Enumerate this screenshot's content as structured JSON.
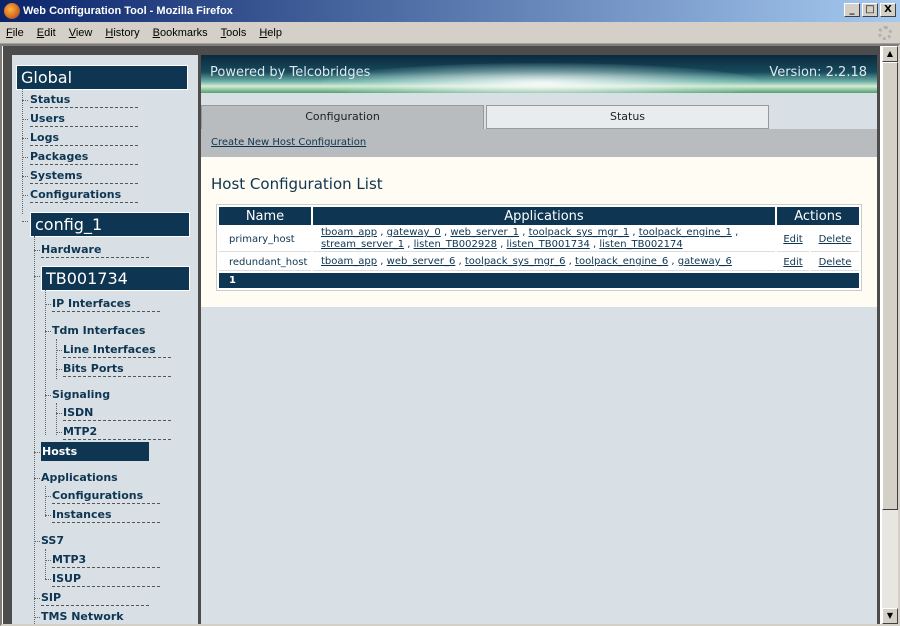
{
  "window": {
    "title": "Web Configuration Tool - Mozilla Firefox",
    "minimize": "_",
    "maximize": "□",
    "close": "X"
  },
  "menu": [
    "File",
    "Edit",
    "View",
    "History",
    "Bookmarks",
    "Tools",
    "Help"
  ],
  "sidebar": {
    "global_header": "Global",
    "global_items": [
      "Status",
      "Users",
      "Logs",
      "Packages",
      "Systems",
      "Configurations"
    ],
    "config_header": "config_1",
    "hardware": "Hardware",
    "device_header": "TB001734",
    "ip_interfaces": "IP Interfaces",
    "tdm_interfaces": "Tdm Interfaces",
    "line_interfaces": "Line Interfaces",
    "bits_ports": "Bits Ports",
    "signaling": "Signaling",
    "isdn": "ISDN",
    "mtp2": "MTP2",
    "hosts": "Hosts",
    "applications": "Applications",
    "app_configurations": "Configurations",
    "instances": "Instances",
    "ss7": "SS7",
    "mtp3": "MTP3",
    "isup": "ISUP",
    "sip": "SIP",
    "tms_network": "TMS Network"
  },
  "banner": {
    "powered": "Powered by Telcobridges",
    "version": "Version: 2.2.18"
  },
  "tabs": {
    "configuration": "Configuration",
    "status": "Status"
  },
  "create_link": "Create New Host Configuration",
  "page_title": "Host Configuration List",
  "table": {
    "headers": [
      "Name",
      "Applications",
      "Actions"
    ],
    "rows": [
      {
        "name": "primary_host",
        "apps_line1": [
          "tboam_app",
          "gateway_0",
          "web_server_1",
          "toolpack_sys_mgr_1",
          "toolpack_engine_1"
        ],
        "apps_line2": [
          "stream_server_1",
          "listen_TB002928",
          "listen_TB001734",
          "listen_TB002174"
        ],
        "edit": "Edit",
        "delete": "Delete"
      },
      {
        "name": "redundant_host",
        "apps_line1": [
          "tboam_app",
          "web_server_6",
          "toolpack_sys_mgr_6",
          "toolpack_engine_6",
          "gateway_6"
        ],
        "apps_line2": [],
        "edit": "Edit",
        "delete": "Delete"
      }
    ],
    "page": "1"
  },
  "colors": {
    "nav_dark": "#0e3551",
    "sidebar_bg": "#d8e0e6",
    "panel_bg": "#fffcf3"
  }
}
